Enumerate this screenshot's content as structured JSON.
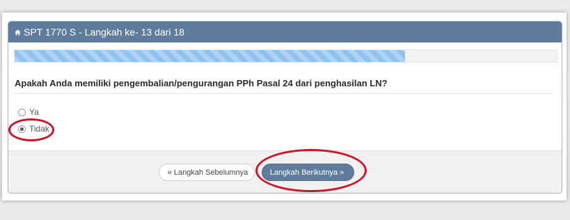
{
  "header": {
    "title": "SPT 1770 S - Langkah ke- 13 dari 18"
  },
  "progress": {
    "fraction": 0.72
  },
  "question": {
    "text": "Apakah Anda memiliki pengembalian/pengurangan PPh Pasal 24 dari penghasilan LN?"
  },
  "options": [
    {
      "label": "Ya",
      "selected": false
    },
    {
      "label": "Tidak",
      "selected": true
    }
  ],
  "buttons": {
    "prev_label": "Langkah Sebelumnya",
    "next_label": "Langkah Berikutnya"
  },
  "colors": {
    "header": "#5f7c9c",
    "progress": "#8fc2ef",
    "annotation": "#d1132a"
  }
}
